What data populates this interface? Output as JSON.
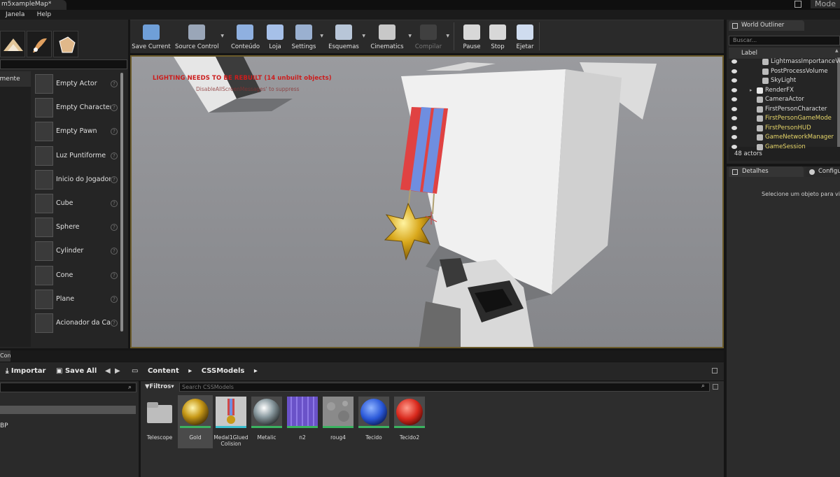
{
  "window": {
    "title": "m5xampleMap*",
    "mode_label": "Mode"
  },
  "menu": [
    "Janela",
    "Help"
  ],
  "place": {
    "category_selected": "emente",
    "items": [
      {
        "label": "Empty Actor"
      },
      {
        "label": "Empty Character"
      },
      {
        "label": "Empty Pawn"
      },
      {
        "label": "Luz Puntiforme"
      },
      {
        "label": "Inicio do Jogador"
      },
      {
        "label": "Cube"
      },
      {
        "label": "Sphere"
      },
      {
        "label": "Cylinder"
      },
      {
        "label": "Cone"
      },
      {
        "label": "Plane"
      },
      {
        "label": "Acionador da Cai"
      }
    ]
  },
  "toolbar": [
    {
      "label": "Save Current",
      "icon": "save-icon"
    },
    {
      "label": "Source Control",
      "icon": "source-control-icon"
    },
    {
      "label": "Conteúdo",
      "icon": "content-icon"
    },
    {
      "label": "Loja",
      "icon": "marketplace-icon"
    },
    {
      "label": "Settings",
      "icon": "settings-icon"
    },
    {
      "label": "Esquemas",
      "icon": "blueprints-icon"
    },
    {
      "label": "Cinematics",
      "icon": "cinematics-icon"
    },
    {
      "label": "Compilar",
      "icon": "compile-icon"
    },
    {
      "label": "Pause",
      "icon": "pause-icon"
    },
    {
      "label": "Stop",
      "icon": "stop-icon"
    },
    {
      "label": "Ejetar",
      "icon": "eject-icon"
    }
  ],
  "viewport": {
    "warning": "LIGHTING NEEDS TO BE REBUILT (14 unbuilt objects)",
    "warning2": "DisableAllScreenMessages' to suppress"
  },
  "outliner": {
    "tab": "World Outliner",
    "search_placeholder": "Buscar...",
    "column_label": "Label",
    "rows": [
      {
        "label": "LightmassImportanceVolu",
        "indent": 2,
        "yellow": false
      },
      {
        "label": "PostProcessVolume",
        "indent": 2,
        "yellow": false
      },
      {
        "label": "SkyLight",
        "indent": 2,
        "yellow": false
      },
      {
        "label": "RenderFX",
        "indent": 1,
        "yellow": false,
        "folder": true
      },
      {
        "label": "CameraActor",
        "indent": 1,
        "yellow": false
      },
      {
        "label": "FirstPersonCharacter",
        "indent": 1,
        "yellow": false
      },
      {
        "label": "FirstPersonGameMode",
        "indent": 1,
        "yellow": true
      },
      {
        "label": "FirstPersonHUD",
        "indent": 1,
        "yellow": true
      },
      {
        "label": "GameNetworkManager",
        "indent": 1,
        "yellow": true
      },
      {
        "label": "GameSession",
        "indent": 1,
        "yellow": true
      }
    ],
    "actor_count": "48 actors"
  },
  "details": {
    "tab": "Detalhes",
    "tab2": "Configu",
    "hint": "Selecione um objeto para vis"
  },
  "content_browser": {
    "tab": "Con",
    "import_label": "Importar",
    "save_all_label": "Save All",
    "crumbs": [
      "Content",
      "CSSModels"
    ],
    "left_item": "BP",
    "filters_label": "Filtros",
    "search_placeholder": "Search CSSModels",
    "assets": [
      {
        "label": "Telescope",
        "kind": "folder"
      },
      {
        "label": "Gold",
        "kind": "gold"
      },
      {
        "label": "Medal1Glued Colision",
        "kind": "medal"
      },
      {
        "label": "Metalic",
        "kind": "metal"
      },
      {
        "label": "n2",
        "kind": "n2"
      },
      {
        "label": "roug4",
        "kind": "rough"
      },
      {
        "label": "Tecido",
        "kind": "blue"
      },
      {
        "label": "Tecido2",
        "kind": "red"
      }
    ]
  }
}
